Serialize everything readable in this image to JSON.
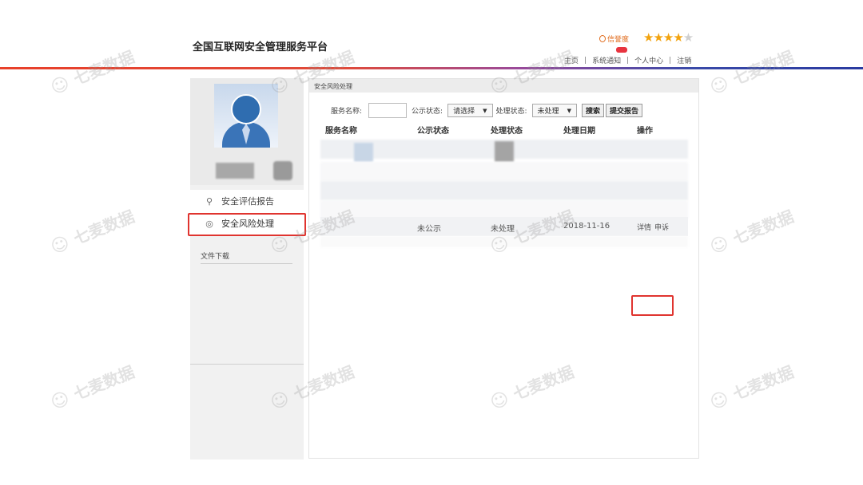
{
  "header": {
    "site_title": "全国互联网安全管理服务平台",
    "credit_label": "信誉度",
    "stars": "★★★★",
    "star_empty": "★",
    "nav": [
      "主页",
      "系统通知",
      "个人中心",
      "注销"
    ]
  },
  "sidebar": {
    "menu": [
      {
        "label": "安全评估报告",
        "icon": "search-icon"
      },
      {
        "label": "安全风险处理",
        "icon": "shield-icon"
      }
    ],
    "downloads_label": "文件下载"
  },
  "main": {
    "panel_title": "安全风险处理",
    "filters": {
      "service_name_label": "服务名称:",
      "publish_status_label": "公示状态:",
      "publish_status_value": "请选择",
      "process_status_label": "处理状态:",
      "process_status_value": "未处理",
      "search_button": "搜索",
      "submit_button": "提交报告"
    },
    "columns": [
      "服务名称",
      "公示状态",
      "处理状态",
      "处理日期",
      "操作"
    ],
    "highlight_row": {
      "publish_status": "未公示",
      "process_status": "未处理",
      "date": "2018-11-16",
      "actions": [
        "详情",
        "申诉"
      ]
    }
  },
  "watermark": "七麦数据",
  "colors": {
    "accent_red": "#e0342f",
    "star_color": "#f2a30f",
    "credit_color": "#e06a1a"
  }
}
